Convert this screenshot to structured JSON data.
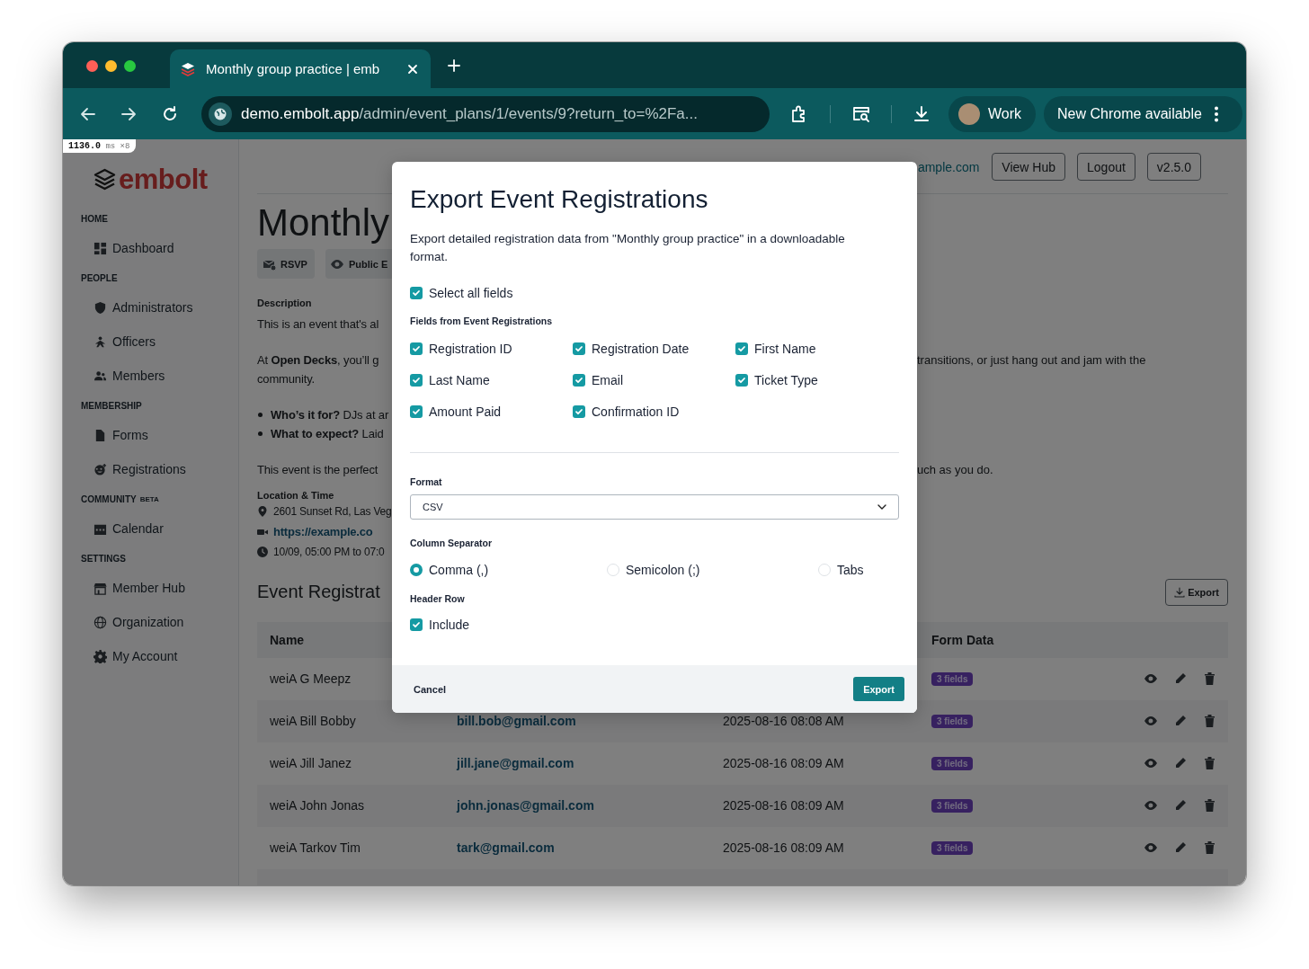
{
  "browser": {
    "tab_title": "Monthly group practice | emb",
    "url_host": "demo.embolt.app",
    "url_path": "/admin/event_plans/1/events/9?return_to=%2Fa...",
    "profile": "Work",
    "update_button": "New Chrome available"
  },
  "timing_badge": {
    "value": "1136.0",
    "unit": "ms",
    "count": "×8"
  },
  "sidebar": {
    "logo": "embolt",
    "sections": [
      {
        "title": "HOME",
        "items": [
          "Dashboard"
        ]
      },
      {
        "title": "PEOPLE",
        "items": [
          "Administrators",
          "Officers",
          "Members"
        ]
      },
      {
        "title": "MEMBERSHIP",
        "items": [
          "Forms",
          "Registrations"
        ]
      },
      {
        "title": "COMMUNITY",
        "badge": "BETA",
        "items": [
          "Calendar"
        ]
      },
      {
        "title": "SETTINGS",
        "items": [
          "Member Hub",
          "Organization",
          "My Account"
        ]
      }
    ]
  },
  "header": {
    "link": "ample.com",
    "buttons": [
      "View Hub",
      "Logout",
      "v2.5.0"
    ]
  },
  "event": {
    "title": "Monthly",
    "chips": [
      "RSVP",
      "Public E"
    ],
    "description_label": "Description",
    "blocks": [
      {
        "kind": "paragraph",
        "lines": [
          {
            "left": "This is an event that's al"
          }
        ]
      },
      {
        "kind": "paragraph",
        "lines": [
          {
            "left": "At **Open Decks**, you’ll g",
            "right": "transitions, or just hang out and jam with the"
          },
          {
            "left": "community."
          }
        ]
      },
      {
        "kind": "bullets",
        "lines": [
          {
            "left": "**Who’s it for?** DJs at ar"
          },
          {
            "left": "**What to expect?** Laid"
          }
        ]
      },
      {
        "kind": "paragraph",
        "lines": [
          {
            "left": "This event is the perfect",
            "right": "uch as you do."
          }
        ]
      }
    ],
    "location_label": "Location & Time",
    "address": "2601 Sunset Rd, Las Veg",
    "link": "https://example.co",
    "time": "10/09, 05:00 PM to 07:0"
  },
  "registrations": {
    "heading": "Event Registrat",
    "export_button": "Export",
    "columns": [
      "Name",
      "Form Data"
    ],
    "rows": [
      {
        "name": "weiA G Meepz",
        "badge": "3 fields"
      },
      {
        "name": "weiA Bill Bobby",
        "email": "bill.bob@gmail.com",
        "date": "2025-08-16 08:08 AM",
        "badge": "3 fields"
      },
      {
        "name": "weiA Jill Janez",
        "email": "jill.jane@gmail.com",
        "date": "2025-08-16 08:09 AM",
        "badge": "3 fields"
      },
      {
        "name": "weiA John Jonas",
        "email": "john.jonas@gmail.com",
        "date": "2025-08-16 08:09 AM",
        "badge": "3 fields"
      },
      {
        "name": "weiA Tarkov Tim",
        "email": "tark@gmail.com",
        "date": "2025-08-16 08:09 AM",
        "badge": "3 fields"
      }
    ]
  },
  "modal": {
    "title": "Export Event Registrations",
    "description": "Export detailed registration data from \"Monthly group practice\" in a downloadable format.",
    "select_all": {
      "label": "Select all fields",
      "checked": true
    },
    "fields_label": "Fields from Event Registrations",
    "fields": [
      {
        "label": "Registration ID",
        "checked": true
      },
      {
        "label": "Registration Date",
        "checked": true
      },
      {
        "label": "First Name",
        "checked": true
      },
      {
        "label": "Last Name",
        "checked": true
      },
      {
        "label": "Email",
        "checked": true
      },
      {
        "label": "Ticket Type",
        "checked": true
      },
      {
        "label": "Amount Paid",
        "checked": true
      },
      {
        "label": "Confirmation ID",
        "checked": true
      }
    ],
    "format_label": "Format",
    "format_value": "CSV",
    "separator_label": "Column Separator",
    "separators": [
      {
        "label": "Comma (,)",
        "selected": true
      },
      {
        "label": "Semicolon (;)",
        "selected": false
      },
      {
        "label": "Tabs",
        "selected": false
      }
    ],
    "header_label": "Header Row",
    "header_option": {
      "label": "Include",
      "checked": true
    },
    "cancel": "Cancel",
    "export": "Export"
  }
}
